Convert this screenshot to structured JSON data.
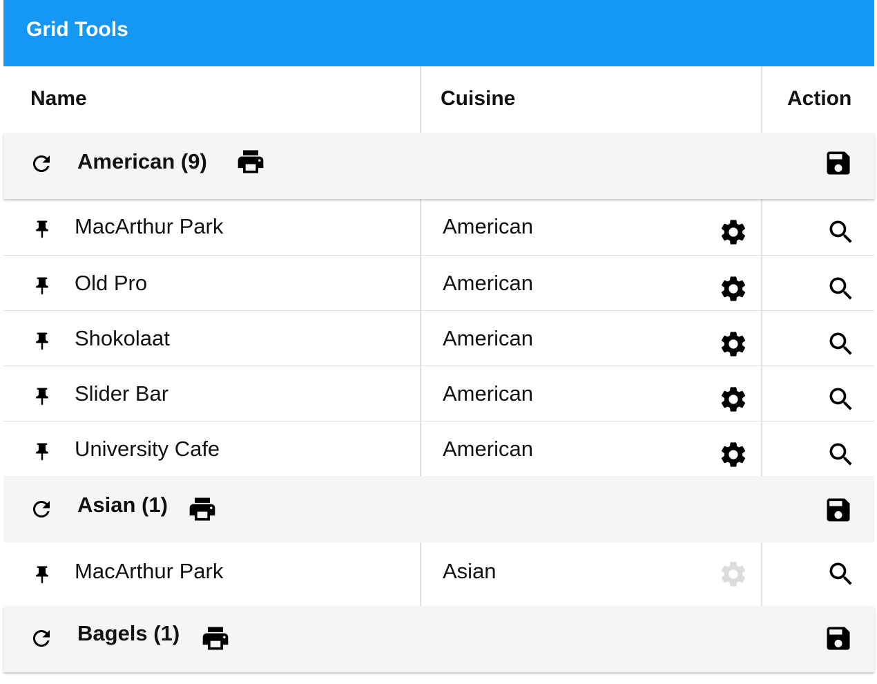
{
  "panel": {
    "title": "Grid Tools"
  },
  "columns": {
    "name": "Name",
    "cuisine": "Cuisine",
    "action": "Action"
  },
  "groups": [
    {
      "label": "American (9)",
      "rows": [
        {
          "name": "MacArthur Park",
          "cuisine": "American",
          "settings_enabled": true
        },
        {
          "name": "Old Pro",
          "cuisine": "American",
          "settings_enabled": true
        },
        {
          "name": "Shokolaat",
          "cuisine": "American",
          "settings_enabled": true
        },
        {
          "name": "Slider Bar",
          "cuisine": "American",
          "settings_enabled": true
        },
        {
          "name": "University Cafe",
          "cuisine": "American",
          "settings_enabled": true
        }
      ]
    },
    {
      "label": "Asian (1)",
      "rows": [
        {
          "name": "MacArthur Park",
          "cuisine": "Asian",
          "settings_enabled": false
        }
      ]
    },
    {
      "label": "Bagels (1)",
      "rows": []
    }
  ],
  "icons": {
    "group_refresh": "refresh-icon",
    "group_print": "print-icon",
    "group_save": "save-icon",
    "row_pin": "pin-icon",
    "row_settings": "gear-icon",
    "row_search": "search-icon"
  },
  "colors": {
    "header_bar": "#1597f5",
    "group_background": "#f5f5f5",
    "disabled_icon": "#dcdcdc"
  }
}
